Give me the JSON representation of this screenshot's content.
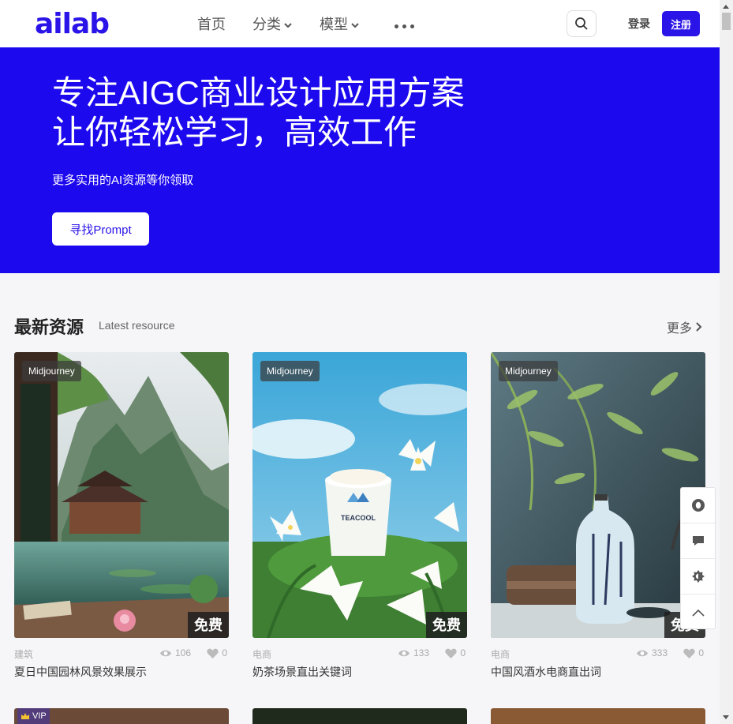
{
  "header": {
    "logo": "ailab",
    "nav": [
      {
        "label": "首页"
      },
      {
        "label": "分类"
      },
      {
        "label": "模型"
      }
    ],
    "login_label": "登录",
    "register_label": "注册"
  },
  "hero": {
    "title_line1": "专注AIGC商业设计应用方案",
    "title_line2": "让你轻松学习，高效工作",
    "subtitle": "更多实用的AI资源等你领取",
    "button_label": "寻找Prompt"
  },
  "section": {
    "title": "最新资源",
    "subtitle": "Latest resource",
    "more_label": "更多"
  },
  "cards": [
    {
      "tag": "Midjourney",
      "badge": "免费",
      "category": "建筑",
      "views": "106",
      "likes": "0",
      "title": "夏日中国园林风景效果展示"
    },
    {
      "tag": "Midjourney",
      "badge": "免费",
      "category": "电商",
      "views": "133",
      "likes": "0",
      "title": "奶茶场景直出关键词"
    },
    {
      "tag": "Midjourney",
      "badge": "免费",
      "category": "电商",
      "views": "333",
      "likes": "0",
      "title": "中国风酒水电商直出词"
    }
  ],
  "row2": {
    "vip_label": "VIP"
  },
  "colors": {
    "brand": "#2a14e8",
    "hero_bg": "#1d09ee"
  }
}
